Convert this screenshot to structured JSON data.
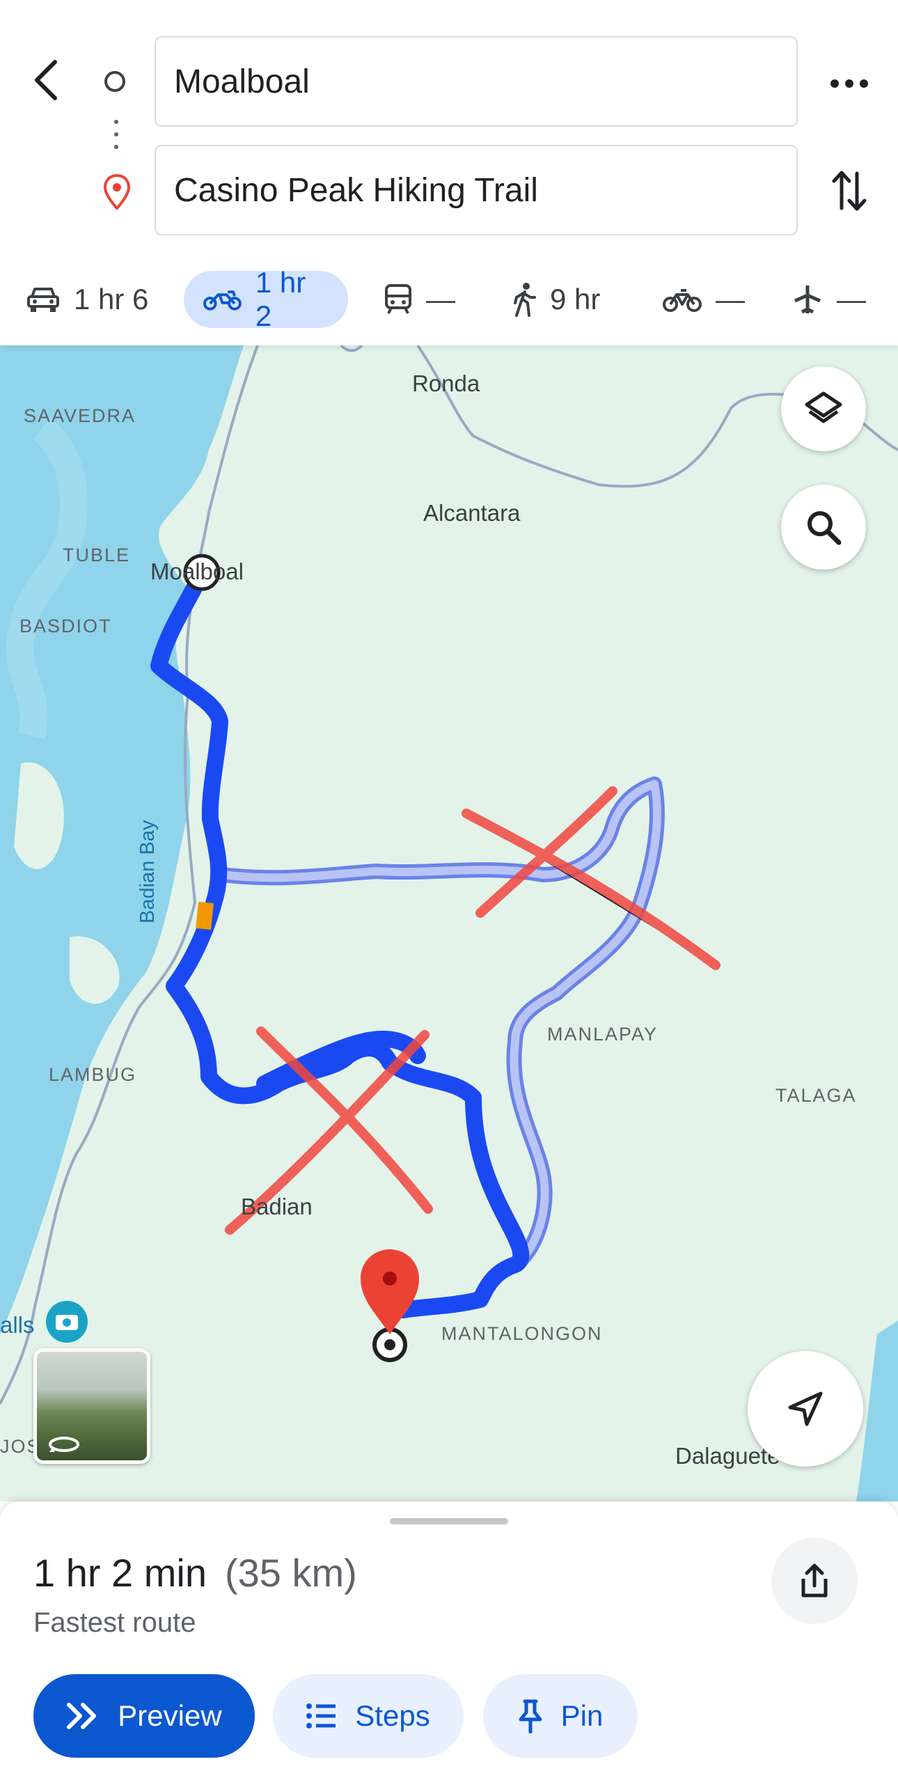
{
  "directions": {
    "origin": "Moalboal",
    "destination": "Casino Peak Hiking Trail"
  },
  "modes": [
    {
      "icon": "car-icon",
      "label": "1 hr 6",
      "selected": false
    },
    {
      "icon": "motorcycle-icon",
      "label": "1 hr 2",
      "selected": true
    },
    {
      "icon": "transit-icon",
      "label": "—",
      "selected": false
    },
    {
      "icon": "walking-icon",
      "label": "9 hr",
      "selected": false
    },
    {
      "icon": "bicycle-icon",
      "label": "—",
      "selected": false
    },
    {
      "icon": "flight-icon",
      "label": "—",
      "selected": false
    }
  ],
  "map": {
    "labels": {
      "ronda": "Ronda",
      "saavedra": "SAAVEDRA",
      "alcantara": "Alcantara",
      "tuble": "TUBLE",
      "moalboal": "Moalboal",
      "basdiot": "BASDIOT",
      "badian_bay": "Badian Bay",
      "manlapay": "MANLAPAY",
      "talaga": "TALAGA",
      "lambug": "LAMBUG",
      "badian": "Badian",
      "mantalongon": "MANTALONGON",
      "dalaguete": "Dalaguete",
      "falls": "alls",
      "jos": "JOS"
    },
    "colors": {
      "land": "#e3f3e9",
      "water": "#8fd4ea",
      "route_primary": "#1a49f2",
      "route_alternate": "#a9b8f2",
      "traffic_segment": "#f29900",
      "annotation_cross": "#f2473f",
      "destination_pin": "#ea4335"
    },
    "icons": {
      "layers": "layers-icon",
      "search": "search-icon",
      "navigate": "navigation-arrow-icon",
      "photo_marker": "camera-marker-icon",
      "street_view": "street-view-thumbnail"
    }
  },
  "sheet": {
    "duration": "1 hr 2 min",
    "distance": "(35 km)",
    "subtitle": "Fastest route",
    "buttons": {
      "preview": "Preview",
      "steps": "Steps",
      "pin": "Pin"
    }
  }
}
